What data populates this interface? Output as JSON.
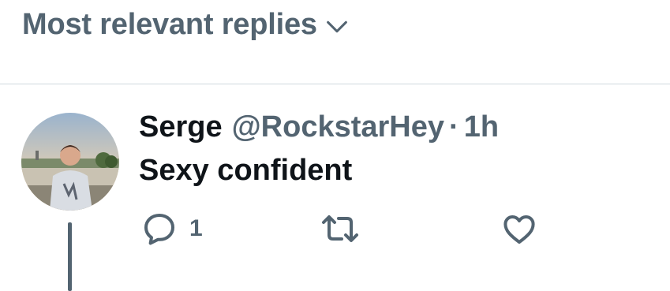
{
  "sort": {
    "label": "Most relevant replies",
    "icon": "chevron-down-icon"
  },
  "reply": {
    "display_name": "Serge",
    "handle": "@RockstarHey",
    "separator": "·",
    "time": "1h",
    "text": "Sexy confident",
    "avatar_icon": "user-avatar-photo",
    "actions": {
      "reply_icon": "reply-icon",
      "reply_count": "1",
      "repost_icon": "repost-icon",
      "like_icon": "heart-icon"
    }
  },
  "colors": {
    "primary_text": "#0f1419",
    "secondary_text": "#536471",
    "divider": "#cfd9de",
    "background": "#ffffff"
  }
}
